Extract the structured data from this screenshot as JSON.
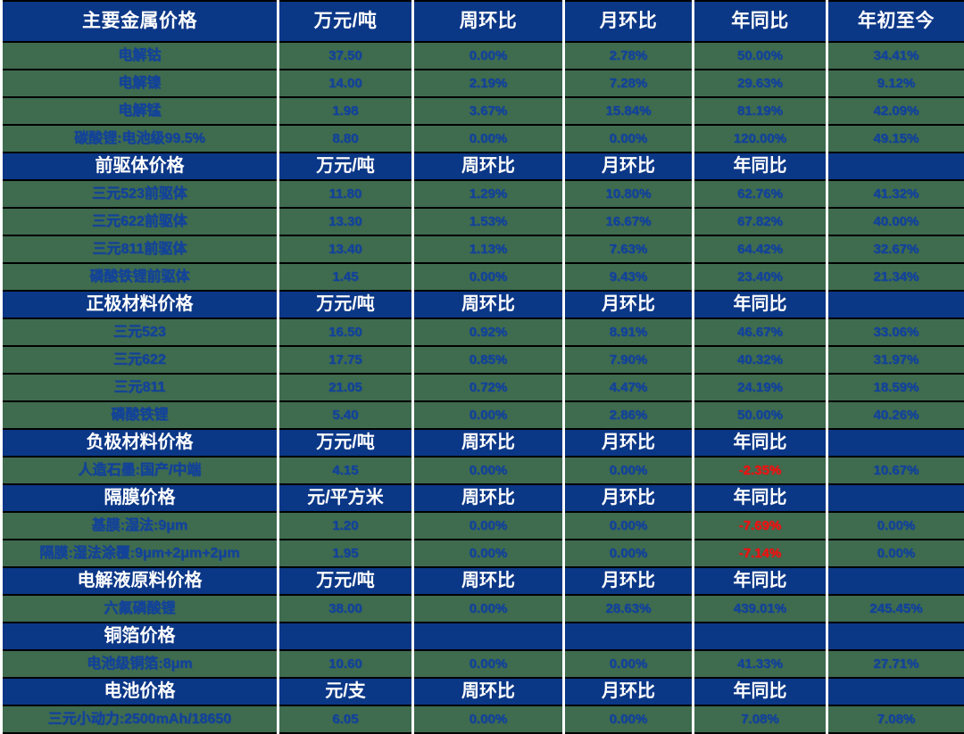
{
  "table": {
    "columns": [
      "主要金属价格",
      "万元/吨",
      "周环比",
      "月环比",
      "年同比",
      "年初至今"
    ],
    "accent_header_bg": "#0b3787",
    "data_row_bg": "#3f6b4f",
    "data_text_color": "#12429a",
    "negative_text_color": "#ee1111",
    "sections": [
      {
        "title": "主要金属价格",
        "unit": "万元/吨",
        "col2": "周环比",
        "col3": "月环比",
        "col4": "年同比",
        "col5": "年初至今",
        "is_main_header": true,
        "rows": [
          {
            "name": "电解钴",
            "price": "37.50",
            "wow": "0.00%",
            "mom": "2.78%",
            "yoy": "50.00%",
            "ytd": "34.41%"
          },
          {
            "name": "电解镍",
            "price": "14.00",
            "wow": "2.19%",
            "mom": "7.28%",
            "yoy": "29.63%",
            "ytd": "9.12%"
          },
          {
            "name": "电解锰",
            "price": "1.98",
            "wow": "3.67%",
            "mom": "15.84%",
            "yoy": "81.19%",
            "ytd": "42.09%"
          },
          {
            "name": "碳酸锂:电池级99.5%",
            "price": "8.80",
            "wow": "0.00%",
            "mom": "0.00%",
            "yoy": "120.00%",
            "ytd": "49.15%"
          }
        ]
      },
      {
        "title": "前驱体价格",
        "unit": "万元/吨",
        "col2": "周环比",
        "col3": "月环比",
        "col4": "年同比",
        "col5": "",
        "is_main_header": false,
        "rows": [
          {
            "name": "三元523前驱体",
            "price": "11.80",
            "wow": "1.29%",
            "mom": "10.80%",
            "yoy": "62.76%",
            "ytd": "41.32%"
          },
          {
            "name": "三元622前驱体",
            "price": "13.30",
            "wow": "1.53%",
            "mom": "16.67%",
            "yoy": "67.82%",
            "ytd": "40.00%"
          },
          {
            "name": "三元811前驱体",
            "price": "13.40",
            "wow": "1.13%",
            "mom": "7.63%",
            "yoy": "64.42%",
            "ytd": "32.67%"
          },
          {
            "name": "磷酸铁锂前驱体",
            "price": "1.45",
            "wow": "0.00%",
            "mom": "9.43%",
            "yoy": "23.40%",
            "ytd": "21.34%"
          }
        ]
      },
      {
        "title": "正极材料价格",
        "unit": "万元/吨",
        "col2": "周环比",
        "col3": "月环比",
        "col4": "年同比",
        "col5": "",
        "is_main_header": false,
        "rows": [
          {
            "name": "三元523",
            "price": "16.50",
            "wow": "0.92%",
            "mom": "8.91%",
            "yoy": "46.67%",
            "ytd": "33.06%"
          },
          {
            "name": "三元622",
            "price": "17.75",
            "wow": "0.85%",
            "mom": "7.90%",
            "yoy": "40.32%",
            "ytd": "31.97%"
          },
          {
            "name": "三元811",
            "price": "21.05",
            "wow": "0.72%",
            "mom": "4.47%",
            "yoy": "24.19%",
            "ytd": "18.59%"
          },
          {
            "name": "磷酸铁锂",
            "price": "5.40",
            "wow": "0.00%",
            "mom": "2.86%",
            "yoy": "50.00%",
            "ytd": "40.26%"
          }
        ]
      },
      {
        "title": "负极材料价格",
        "unit": "万元/吨",
        "col2": "周环比",
        "col3": "月环比",
        "col4": "年同比",
        "col5": "",
        "is_main_header": false,
        "rows": [
          {
            "name": "人造石墨:国产/中端",
            "price": "4.15",
            "wow": "0.00%",
            "mom": "0.00%",
            "yoy": "-2.35%",
            "yoy_negative": true,
            "ytd": "10.67%"
          }
        ]
      },
      {
        "title": "隔膜价格",
        "unit": "元/平方米",
        "col2": "周环比",
        "col3": "月环比",
        "col4": "年同比",
        "col5": "",
        "is_main_header": false,
        "rows": [
          {
            "name": "基膜:湿法:9μm",
            "price": "1.20",
            "wow": "0.00%",
            "mom": "0.00%",
            "yoy": "-7.69%",
            "yoy_negative": true,
            "ytd": "0.00%"
          },
          {
            "name": "隔膜:湿法涂覆:9μm+2μm+2μm",
            "price": "1.95",
            "wow": "0.00%",
            "mom": "0.00%",
            "yoy": "-7.14%",
            "yoy_negative": true,
            "ytd": "0.00%"
          }
        ]
      },
      {
        "title": "电解液原料价格",
        "unit": "万元/吨",
        "col2": "周环比",
        "col3": "月环比",
        "col4": "年同比",
        "col5": "",
        "is_main_header": false,
        "rows": [
          {
            "name": "六氟磷酸锂",
            "price": "38.00",
            "wow": "0.00%",
            "mom": "28.63%",
            "yoy": "439.01%",
            "ytd": "245.45%"
          }
        ]
      },
      {
        "title": "铜箔价格",
        "unit": "",
        "col2": "",
        "col3": "",
        "col4": "",
        "col5": "",
        "is_main_header": false,
        "rows": [
          {
            "name": "电池级铜箔:8μm",
            "price": "10.60",
            "wow": "0.00%",
            "mom": "0.00%",
            "yoy": "41.33%",
            "ytd": "27.71%"
          }
        ]
      },
      {
        "title": "电池价格",
        "unit": "元/支",
        "col2": "周环比",
        "col3": "月环比",
        "col4": "年同比",
        "col5": "",
        "is_main_header": false,
        "rows": [
          {
            "name": "三元小动力:2500mAh/18650",
            "price": "6.05",
            "wow": "0.00%",
            "mom": "0.00%",
            "yoy": "7.08%",
            "ytd": "7.08%"
          }
        ]
      }
    ]
  }
}
